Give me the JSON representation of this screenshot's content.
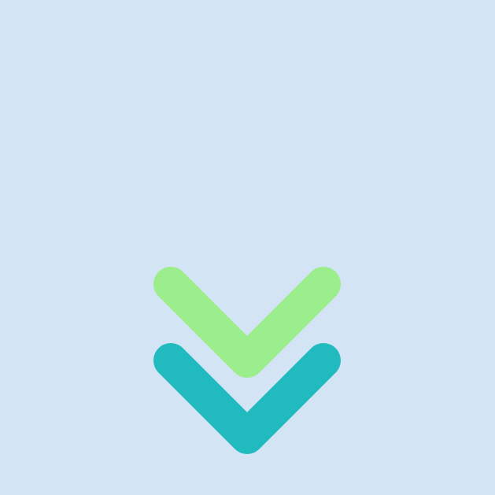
{
  "background_color": "#d3e4f4",
  "icon": {
    "name": "double-chevron-down-icon",
    "upper_chevron_color": "#9ced8b",
    "lower_chevron_color": "#21bbbf"
  }
}
